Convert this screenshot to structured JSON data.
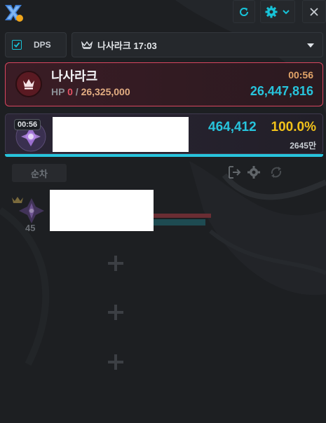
{
  "titlebar": {
    "logo_icon": "app-logo-icon",
    "refresh_icon": "refresh-icon",
    "settings_icon": "gear-icon",
    "settings_dropdown_icon": "chevron-down-icon",
    "close_icon": "close-icon",
    "accent": "#17c3d8"
  },
  "controls": {
    "dps_toggle": {
      "label": "DPS",
      "checked": true
    },
    "raid_select": {
      "icon": "crown-icon",
      "value": "나사라크 17:03"
    }
  },
  "boss": {
    "name": "나사라크",
    "hp_label": "HP",
    "hp_current": "0",
    "hp_separator": "/",
    "hp_max": "26,325,000",
    "elapsed": "00:56",
    "total_damage": "26,447,816",
    "icon": "boss-crown-icon"
  },
  "player": {
    "time": "00:56",
    "dps": "464,412",
    "percent": "100.0%",
    "total": "2645만",
    "bar_fill_percent": 100
  },
  "rotation": {
    "sort_label": "순차",
    "icons": [
      "exit-icon",
      "gear-icon",
      "swap-icon"
    ]
  },
  "party": {
    "level": "45",
    "leader_icon": "crown-icon"
  },
  "empty_slots": [
    "add-slot-icon",
    "add-slot-icon",
    "add-slot-icon"
  ],
  "colors": {
    "background": "#1d1f22",
    "cyan": "#27c4dc",
    "gold": "#f2c21a",
    "boss_border": "#d8465f"
  }
}
